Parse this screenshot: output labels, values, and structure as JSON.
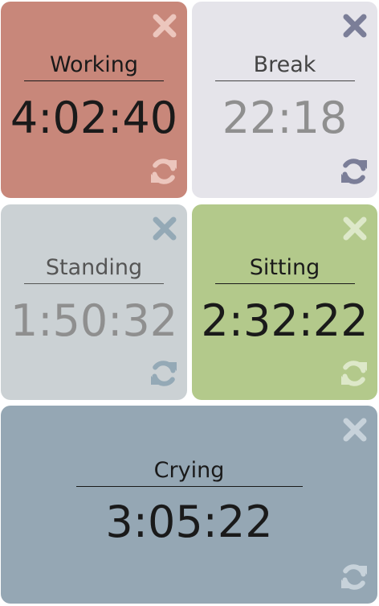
{
  "timers": [
    {
      "label": "Working",
      "time": "4:02:40",
      "active": true,
      "colors": {
        "background": "#c8877a",
        "text": "#1a1a1a",
        "label": "#1a1a1a",
        "icon": "#ecc6bd"
      },
      "close_icon": "close-icon",
      "reset_icon": "refresh-icon"
    },
    {
      "label": "Break",
      "time": "22:18",
      "active": false,
      "colors": {
        "background": "#e5e4ea",
        "text": "#8f8f8f",
        "label": "#444444",
        "icon": "#7b7e98"
      },
      "close_icon": "close-icon",
      "reset_icon": "refresh-icon"
    },
    {
      "label": "Standing",
      "time": "1:50:32",
      "active": false,
      "colors": {
        "background": "#cbd1d4",
        "text": "#8f8f8f",
        "label": "#555555",
        "icon": "#94a9b6"
      },
      "close_icon": "close-icon",
      "reset_icon": "refresh-icon"
    },
    {
      "label": "Sitting",
      "time": "2:32:22",
      "active": true,
      "colors": {
        "background": "#b3c98b",
        "text": "#1a1a1a",
        "label": "#1a1a1a",
        "icon": "#dde8c9"
      },
      "close_icon": "close-icon",
      "reset_icon": "refresh-icon"
    },
    {
      "label": "Crying",
      "time": "3:05:22",
      "active": true,
      "colors": {
        "background": "#95a7b4",
        "text": "#1a1a1a",
        "label": "#1a1a1a",
        "icon": "#c7d2da"
      },
      "close_icon": "close-icon",
      "reset_icon": "refresh-icon"
    }
  ]
}
